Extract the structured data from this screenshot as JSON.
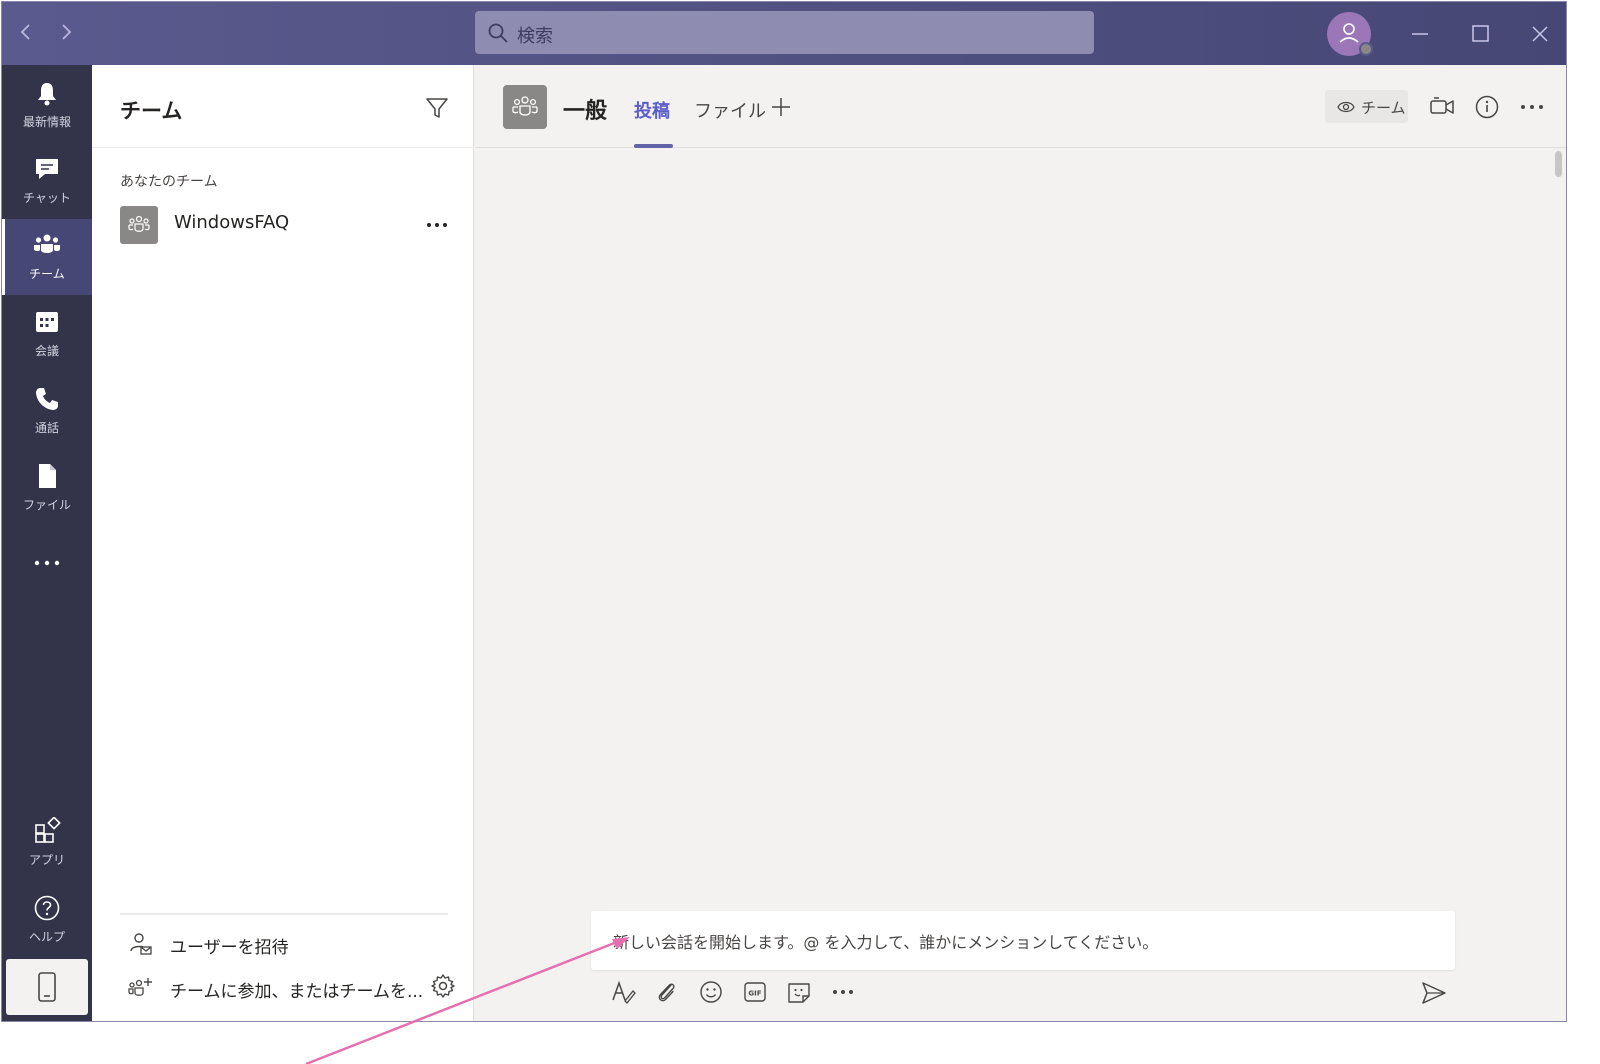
{
  "search": {
    "placeholder": "検索"
  },
  "rail": {
    "items": [
      {
        "label": "最新情報",
        "icon": "bell-icon"
      },
      {
        "label": "チャット",
        "icon": "chat-icon"
      },
      {
        "label": "チーム",
        "icon": "teams-icon",
        "active": true
      },
      {
        "label": "会議",
        "icon": "calendar-icon"
      },
      {
        "label": "通話",
        "icon": "phone-icon"
      },
      {
        "label": "ファイル",
        "icon": "file-icon"
      }
    ],
    "bottom": [
      {
        "label": "アプリ",
        "icon": "apps-icon"
      },
      {
        "label": "ヘルプ",
        "icon": "help-icon"
      }
    ]
  },
  "teams_panel": {
    "title": "チーム",
    "section_label": "あなたのチーム",
    "teams": [
      {
        "name": "WindowsFAQ"
      }
    ],
    "invite_label": "ユーザーを招待",
    "join_label": "チームに参加、またはチームを..."
  },
  "channel": {
    "name": "一般",
    "tabs": [
      {
        "label": "投稿",
        "active": true
      },
      {
        "label": "ファイル"
      }
    ],
    "team_chip_label": "チーム"
  },
  "compose": {
    "placeholder": "新しい会話を開始します。@ を入力して、誰かにメンションしてください。"
  },
  "colors": {
    "titlebar": "#464775",
    "rail": "#33344a",
    "accent": "#6264a7",
    "annotation_arrow": "#e66fb0"
  }
}
